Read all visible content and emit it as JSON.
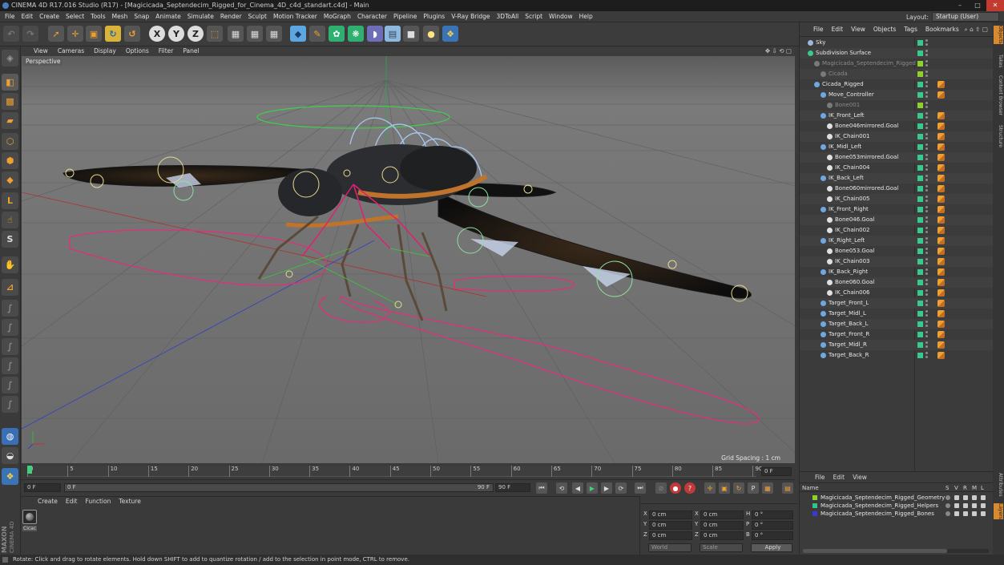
{
  "window": {
    "title": "CINEMA 4D R17.016 Studio (R17) - [Magicicada_Septendecim_Rigged_for_Cinema_4D_c4d_standart.c4d] - Main"
  },
  "menubar": {
    "items": [
      "File",
      "Edit",
      "Create",
      "Select",
      "Tools",
      "Mesh",
      "Snap",
      "Animate",
      "Simulate",
      "Render",
      "Sculpt",
      "Motion Tracker",
      "MoGraph",
      "Character",
      "Pipeline",
      "Plugins",
      "V-Ray Bridge",
      "3DToAll",
      "Script",
      "Window",
      "Help"
    ],
    "layout_label": "Layout:",
    "layout_value": "Startup (User)"
  },
  "toolbar": {
    "axis_x": "X",
    "axis_y": "Y",
    "axis_z": "Z"
  },
  "viewport": {
    "menu": [
      "View",
      "Cameras",
      "Display",
      "Options",
      "Filter",
      "Panel"
    ],
    "camera_label": "Perspective",
    "grid_spacing": "Grid Spacing : 1 cm"
  },
  "timeline": {
    "ticks": [
      "0",
      "5",
      "10",
      "15",
      "20",
      "25",
      "30",
      "35",
      "40",
      "45",
      "50",
      "55",
      "60",
      "65",
      "70",
      "75",
      "80",
      "85",
      "90"
    ],
    "current_frame": "0 F",
    "start_field": "0 F",
    "range_start": "0 F",
    "range_end": "90 F",
    "end_field": "90 F"
  },
  "material_panel": {
    "menu": [
      "Create",
      "Edit",
      "Function",
      "Texture"
    ],
    "material_name": "Cicac"
  },
  "coord_panel": {
    "rows": [
      {
        "axis": "X",
        "pos": "0 cm",
        "axis2": "X",
        "size": "0 cm",
        "rot_axis": "H",
        "rot": "0 °"
      },
      {
        "axis": "Y",
        "pos": "0 cm",
        "axis2": "Y",
        "size": "0 cm",
        "rot_axis": "P",
        "rot": "0 °"
      },
      {
        "axis": "Z",
        "pos": "0 cm",
        "axis2": "Z",
        "size": "0 cm",
        "rot_axis": "B",
        "rot": "0 °"
      }
    ],
    "mode_world": "World",
    "mode_scale": "Scale",
    "apply": "Apply"
  },
  "object_manager": {
    "menu": [
      "File",
      "Edit",
      "View",
      "Objects",
      "Tags",
      "Bookmarks"
    ],
    "objects": [
      {
        "name": "Sky",
        "indent": 0,
        "color": "#9fb8d8"
      },
      {
        "name": "Subdivision Surface",
        "indent": 0,
        "color": "#38c98c"
      },
      {
        "name": "Magicicada_Septendecim_Rigged",
        "indent": 1,
        "color": "#7a7a7a",
        "dim": true
      },
      {
        "name": "Cicada",
        "indent": 2,
        "color": "#7a7a7a",
        "dim": true
      },
      {
        "name": "Cicada_Rigged",
        "indent": 1,
        "color": "#6fa8e0"
      },
      {
        "name": "Move_Controller",
        "indent": 2,
        "color": "#6fa8e0"
      },
      {
        "name": "Bone001",
        "indent": 3,
        "color": "#7a7a7a",
        "dim": true
      },
      {
        "name": "IK_Front_Left",
        "indent": 2,
        "color": "#6fa8e0"
      },
      {
        "name": "Bone046mirrored.Goal",
        "indent": 3,
        "color": "#e0e0e0"
      },
      {
        "name": "IK_Chain001",
        "indent": 3,
        "color": "#e0e0e0"
      },
      {
        "name": "IK_Midl_Left",
        "indent": 2,
        "color": "#6fa8e0"
      },
      {
        "name": "Bone053mirrored.Goal",
        "indent": 3,
        "color": "#e0e0e0"
      },
      {
        "name": "IK_Chain004",
        "indent": 3,
        "color": "#e0e0e0"
      },
      {
        "name": "IK_Back_Left",
        "indent": 2,
        "color": "#6fa8e0"
      },
      {
        "name": "Bone060mirrored.Goal",
        "indent": 3,
        "color": "#e0e0e0"
      },
      {
        "name": "IK_Chain005",
        "indent": 3,
        "color": "#e0e0e0"
      },
      {
        "name": "IK_Front_Right",
        "indent": 2,
        "color": "#6fa8e0"
      },
      {
        "name": "Bone046.Goal",
        "indent": 3,
        "color": "#e0e0e0"
      },
      {
        "name": "IK_Chain002",
        "indent": 3,
        "color": "#e0e0e0"
      },
      {
        "name": "IK_Right_Left",
        "indent": 2,
        "color": "#6fa8e0"
      },
      {
        "name": "Bone053.Goal",
        "indent": 3,
        "color": "#e0e0e0"
      },
      {
        "name": "IK_Chain003",
        "indent": 3,
        "color": "#e0e0e0"
      },
      {
        "name": "IK_Back_Right",
        "indent": 2,
        "color": "#6fa8e0"
      },
      {
        "name": "Bone060.Goal",
        "indent": 3,
        "color": "#e0e0e0"
      },
      {
        "name": "IK_Chain006",
        "indent": 3,
        "color": "#e0e0e0"
      },
      {
        "name": "Target_Front_L",
        "indent": 2,
        "color": "#6fa8e0"
      },
      {
        "name": "Target_Midl_L",
        "indent": 2,
        "color": "#6fa8e0"
      },
      {
        "name": "Target_Back_L",
        "indent": 2,
        "color": "#6fa8e0"
      },
      {
        "name": "Target_Front_R",
        "indent": 2,
        "color": "#6fa8e0"
      },
      {
        "name": "Target_Midl_R",
        "indent": 2,
        "color": "#6fa8e0"
      },
      {
        "name": "Target_Back_R",
        "indent": 2,
        "color": "#6fa8e0"
      }
    ]
  },
  "layer_manager": {
    "menu": [
      "File",
      "Edit",
      "View"
    ],
    "header_name": "Name",
    "header_cols": [
      "S",
      "V",
      "R",
      "M",
      "L"
    ],
    "layers": [
      {
        "name": "Magicicada_Septendecim_Rigged_Geometry",
        "color": "#8fd12a"
      },
      {
        "name": "Magicicada_Septendecim_Rigged_Helpers",
        "color": "#2ec48a"
      },
      {
        "name": "Magicicada_Septendecim_Rigged_Bones",
        "color": "#3b3ad0"
      }
    ]
  },
  "side_tabs": [
    "Objects",
    "Takes",
    "Content Browser",
    "Structure",
    "Attributes",
    "Layers"
  ],
  "status": {
    "text": "Rotate: Click and drag to rotate elements. Hold down SHIFT to add to quantize rotation / add to the selection in point mode, CTRL to remove."
  },
  "brand": {
    "maxon": "MAXON",
    "cinema": "CINEMA 4D"
  }
}
